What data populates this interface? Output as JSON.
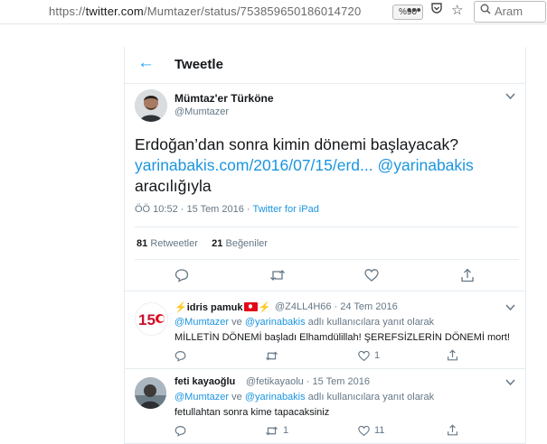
{
  "browser": {
    "url_prefix": "https://",
    "url_domain": "twitter.com",
    "url_path": "/Mumtazer/status/753859650186014720",
    "zoom": "%90",
    "search_placeholder": "Aram"
  },
  "header": {
    "title": "Tweetle"
  },
  "tweet": {
    "author_name": "Mümtaz'er Türköne",
    "author_handle": "@Mumtazer",
    "text_line1": "Erdoğan’dan sonra kimin dönemi başlayacak?",
    "link": "yarinabakis.com/2016/07/15/erd...",
    "mention": "@yarinabakis",
    "text_line3": "aracılığıyla",
    "time": "ÖÖ 10:52 · 15 Tem 2016 · ",
    "source": "Twitter for iPad",
    "retweets_count": "81",
    "retweets_label": "Retweetler",
    "likes_count": "21",
    "likes_label": "Beğeniler"
  },
  "replies": [
    {
      "name": "idris pamuk",
      "handle_date": "@Z4LL4H66 · 24 Tem 2016",
      "mention1": "@Mumtazer",
      "conj": " ve ",
      "mention2": "@yarinabakis",
      "reply_suffix": " adlı kullanıcılara yanıt olarak",
      "text": "MİLLETİN DÖNEMİ başladı Elhamdülillah! ŞEREFSİZLERİN DÖNEMİ mort!",
      "retweets": "",
      "likes": "1",
      "avatar_text": "15"
    },
    {
      "name": "feti kayaoğlu",
      "handle_date": "@fetikayaolu · 15 Tem 2016",
      "mention1": "@Mumtazer",
      "conj": " ve ",
      "mention2": "@yarinabakis",
      "reply_suffix": " adlı kullanıcılara yanıt olarak",
      "text": "fetullahtan sonra kime tapacaksiniz",
      "retweets": "1",
      "likes": "11",
      "avatar_text": ""
    }
  ],
  "icons": {
    "back": "arrow-left-icon",
    "reply": "reply-icon",
    "retweet": "retweet-icon",
    "like": "heart-icon",
    "share": "share-icon",
    "more": "chevron-down-icon"
  },
  "colors": {
    "accent": "#1da1f2",
    "link": "#1b95e0",
    "muted": "#657786",
    "border": "#e6ecf0"
  }
}
